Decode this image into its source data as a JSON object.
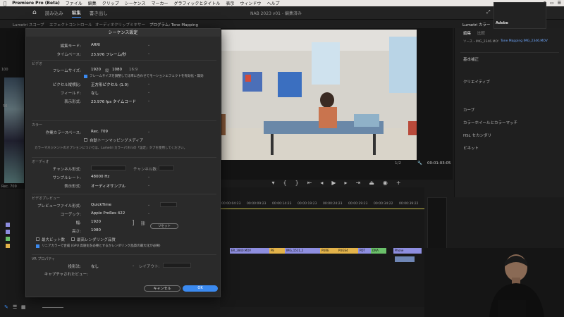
{
  "menubar": {
    "apple": "",
    "app_name": "Premiere Pro (Beta)",
    "items": [
      "ファイル",
      "編集",
      "クリップ",
      "シーケンス",
      "マーカー",
      "グラフィックとタイトル",
      "表示",
      "ウィンドウ",
      "ヘルプ"
    ]
  },
  "header": {
    "tabs": [
      "読み込み",
      "編集",
      "書き出し"
    ],
    "active_tab_index": 1,
    "project_title": "NAB 2023 v01 - 編集済み"
  },
  "panels": {
    "left_tabs": [
      "Lumetri スコープ",
      "エフェクトコントロール",
      "オーディオクリップミキサー",
      "プログラム: Tone Mapping"
    ],
    "right_tab": "Lumetri カラー",
    "right_tabs": [
      "編集",
      "比較"
    ]
  },
  "scope": {
    "labels": [
      "100",
      "50",
      "Rec. 709"
    ]
  },
  "dialog": {
    "title": "シーケンス設定",
    "rows": {
      "editing_mode_label": "編集モード:",
      "editing_mode_value": "ARRI",
      "timebase_label": "タイムベース:",
      "timebase_value": "23.976 フレーム/秒",
      "video_section": "ビデオ",
      "frame_size_label": "フレームサイズ:",
      "frame_w": "1920",
      "frame_h": "1080",
      "frame_h_label": "縦",
      "frame_aspect": "16:9",
      "scale_checkbox": "フレームサイズを調整して比率に合わせてモーションエフェクトを有効化・無効",
      "pixel_aspect_label": "ピクセル縦横比:",
      "pixel_aspect_value": "正方形ピクセル (1.0)",
      "fields_label": "フィールド:",
      "fields_value": "なし",
      "display_format_label": "表示形式:",
      "display_format_value": "23.976 fps タイムコード",
      "color_section": "カラー",
      "working_space_label": "作業カラースペース:",
      "working_space_value": "Rec. 709",
      "auto_tone_map": "自動トーンマッピングメディア",
      "color_note": "カラーマネジメントのオプションについては、Lumetri カラーパネルの「設定」タブを使用してください。",
      "audio_section": "オーディオ",
      "channel_format_label": "チャンネル形式:",
      "channels_label": "チャンネル数:",
      "sample_rate_label": "サンプルレート:",
      "sample_rate_value": "48000 Hz",
      "audio_display_label": "表示形式:",
      "audio_display_value": "オーディオサンプル",
      "preview_section": "ビデオプレビュー",
      "preview_format_label": "プレビューファイル形式:",
      "preview_format_value": "QuickTime",
      "codec_label": "コーデック:",
      "codec_value": "Apple ProRes 422",
      "width_label": "幅:",
      "width_value": "1920",
      "height_label": "高さ:",
      "height_value": "1080",
      "reset_button": "リセット",
      "max_bit_depth": "最大ビット数",
      "max_render_quality": "最高レンダリング品質",
      "linear_color": "リニアカラーで合成 (GPU 高速化を必要とするかレンダリング品質の最大化が必要)",
      "vr_section": "VR プロパティ",
      "projection_label": "投影法:",
      "projection_value": "なし",
      "layout_label": "レイアウト:",
      "captured_view_label": "キャプチャされたビュー:",
      "cancel": "キャンセル",
      "ok": "OK"
    }
  },
  "monitor": {
    "fit_label": "1/2",
    "timecode": "00:01:03:05"
  },
  "lumetri": {
    "source": "ソース・IMG_2346.MOV",
    "target": "Tone Mapping IMG_2346.MOV",
    "section_items": [
      "基本補正",
      "クリエイティブ",
      "カーブ",
      "カラーホイールとカラーマッチ",
      "HSL セカンダリ",
      "ビネット"
    ]
  },
  "timeline": {
    "ruler": [
      "00:00:04:23",
      "00:00:09:23",
      "00:00:14:23",
      "00:00:19:23",
      "00:00:24:23",
      "00:00:29:23",
      "00:00:34:22",
      "00:00:39:22"
    ],
    "clips": [
      {
        "label": "ER_2840.MOV",
        "color": "#8e8ee0"
      },
      {
        "label": "PE",
        "color": "#e3b34a"
      },
      {
        "label": "IMG_1511_1",
        "color": "#8e8ee0"
      },
      {
        "label": "PURE",
        "color": "#e3b34a"
      },
      {
        "label": "PUGS4",
        "color": "#e3b34a"
      },
      {
        "label": "PDT",
        "color": "#8e8ee0"
      },
      {
        "label": "DNA",
        "color": "#6ac06a"
      },
      {
        "label": "Phone",
        "color": "#8e8ee0"
      }
    ]
  },
  "webcam": {
    "label": "Adobe"
  }
}
